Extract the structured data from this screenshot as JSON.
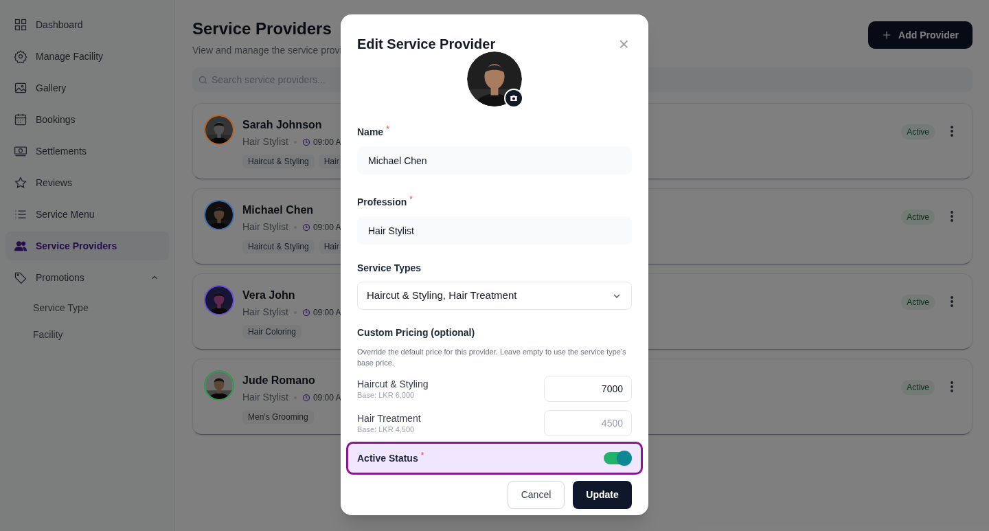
{
  "sidebar": {
    "items": [
      {
        "label": "Dashboard",
        "selected": false
      },
      {
        "label": "Manage Facility",
        "selected": false
      },
      {
        "label": "Gallery",
        "selected": false
      },
      {
        "label": "Bookings",
        "selected": false
      },
      {
        "label": "Settlements",
        "selected": false
      },
      {
        "label": "Reviews",
        "selected": false
      },
      {
        "label": "Service Menu",
        "selected": false
      },
      {
        "label": "Service Providers",
        "selected": true
      },
      {
        "label": "Promotions",
        "selected": false,
        "expanded": true,
        "children": [
          {
            "label": "Service Type"
          },
          {
            "label": "Facility"
          }
        ]
      }
    ]
  },
  "page": {
    "title": "Service Providers",
    "subtitle": "View and manage the service provi",
    "add_button": "Add Provider",
    "search": {
      "placeholder": "Search service providers..."
    }
  },
  "providers": [
    {
      "name": "Sarah Johnson",
      "profession": "Hair Stylist",
      "time": "09:00 A",
      "color": "#b5652a",
      "tags": [
        "Haircut & Styling",
        "Hair"
      ],
      "status": "Active"
    },
    {
      "name": "Michael Chen",
      "profession": "Hair Stylist",
      "time": "09:00 A",
      "color": "#3d6bb0",
      "tags": [
        "Haircut & Styling",
        "Hair"
      ],
      "status": "Active"
    },
    {
      "name": "Vera John",
      "profession": "Hair Stylist",
      "time": "09:00 A",
      "color": "#6a4fd0",
      "tags": [
        "Hair Coloring"
      ],
      "status": "Active"
    },
    {
      "name": "Jude Romano",
      "profession": "Hair Stylist",
      "time": "09:00 A",
      "color": "#2e9a4a",
      "tags": [
        "Men's Grooming"
      ],
      "status": "Active"
    }
  ],
  "dialog": {
    "title": "Edit Service Provider",
    "close": "×",
    "fields": [
      {
        "label": "Name",
        "required_mark": "*",
        "value": "Michael Chen"
      },
      {
        "label": "Profession",
        "required_mark": "*",
        "value": "Hair Stylist"
      }
    ],
    "service_types": {
      "label": "Service Types",
      "value": "Haircut & Styling, Hair Treatment"
    },
    "custom_pricing": {
      "title": "Custom Pricing (optional)",
      "description": "Override the default price for this provider. Leave empty to use the service type's base price.",
      "items": [
        {
          "label": "Haircut & Styling",
          "base": "Base: LKR 6,000",
          "value": "7000"
        },
        {
          "label": "Hair Treatment",
          "base": "Base: LKR 4,500",
          "placeholder": "4500"
        }
      ]
    },
    "active_status": {
      "label": "Active Status",
      "required_mark": "*",
      "on": true
    },
    "buttons": {
      "cancel": "Cancel",
      "submit": "Update"
    }
  }
}
